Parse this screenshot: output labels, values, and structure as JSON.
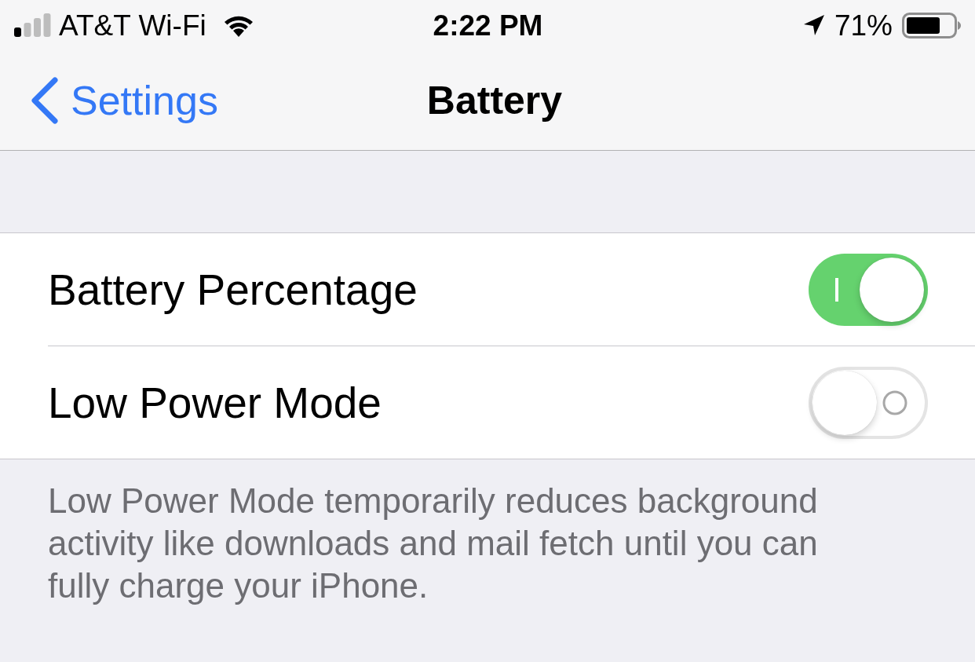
{
  "status_bar": {
    "carrier": "AT&T Wi-Fi",
    "time": "2:22 PM",
    "battery_percent": "71%"
  },
  "nav_bar": {
    "back_label": "Settings",
    "title": "Battery"
  },
  "rows": [
    {
      "label": "Battery Percentage",
      "on": true
    },
    {
      "label": "Low Power Mode",
      "on": false
    }
  ],
  "footer": "Low Power Mode temporarily reduces background activity like downloads and mail fetch until you can fully charge your iPhone."
}
